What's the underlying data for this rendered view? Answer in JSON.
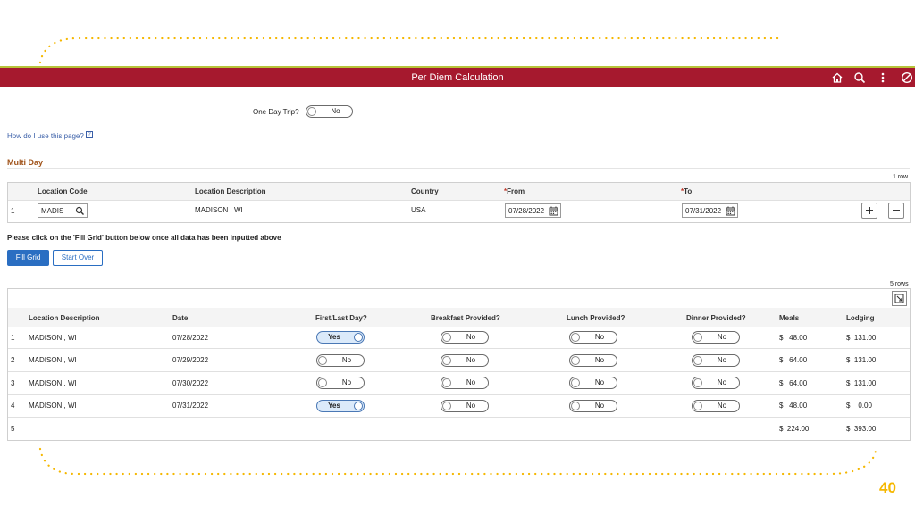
{
  "header": {
    "title": "Per Diem Calculation",
    "icons": [
      "home-icon",
      "search-icon",
      "more-icon",
      "ban-icon"
    ]
  },
  "one_day_trip": {
    "label": "One Day Trip?",
    "value": "No"
  },
  "help_link": "How do I use this page?",
  "section_title": "Multi Day",
  "location_grid": {
    "row_count": "1 row",
    "headers": {
      "location_code": "Location Code",
      "location_description": "Location Description",
      "country": "Country",
      "from_req": "*",
      "from": "From",
      "to_req": "*",
      "to": "To"
    },
    "row": {
      "num": "1",
      "location_code": "MADIS",
      "location_description": "MADISON , WI",
      "country": "USA",
      "from": "07/28/2022",
      "to": "07/31/2022"
    }
  },
  "instruction": "Please click on the 'Fill Grid' button below once all data has been inputted above",
  "buttons": {
    "fill_grid": "Fill Grid",
    "start_over": "Start Over"
  },
  "per_diem_grid": {
    "row_count": "5 rows",
    "headers": {
      "location_description": "Location Description",
      "date": "Date",
      "first_last_day": "First/Last Day?",
      "breakfast": "Breakfast Provided?",
      "lunch": "Lunch Provided?",
      "dinner": "Dinner Provided?",
      "meals": "Meals",
      "lodging": "Lodging"
    },
    "rows": [
      {
        "num": "1",
        "location": "MADISON , WI",
        "date": "07/28/2022",
        "first_last": "Yes",
        "breakfast": "No",
        "lunch": "No",
        "dinner": "No",
        "meals": "$   48.00",
        "lodging": "$  131.00"
      },
      {
        "num": "2",
        "location": "MADISON , WI",
        "date": "07/29/2022",
        "first_last": "No",
        "breakfast": "No",
        "lunch": "No",
        "dinner": "No",
        "meals": "$   64.00",
        "lodging": "$  131.00"
      },
      {
        "num": "3",
        "location": "MADISON , WI",
        "date": "07/30/2022",
        "first_last": "No",
        "breakfast": "No",
        "lunch": "No",
        "dinner": "No",
        "meals": "$   64.00",
        "lodging": "$  131.00"
      },
      {
        "num": "4",
        "location": "MADISON , WI",
        "date": "07/31/2022",
        "first_last": "Yes",
        "breakfast": "No",
        "lunch": "No",
        "dinner": "No",
        "meals": "$   48.00",
        "lodging": "$    0.00"
      }
    ],
    "totals": {
      "num": "5",
      "meals": "$  224.00",
      "lodging": "$  393.00"
    }
  },
  "slide_number": "40",
  "colors": {
    "header_bg": "#a6192e",
    "accent_gold": "#f5b700",
    "primary_blue": "#2a6ec2",
    "section_title": "#a0531a"
  }
}
